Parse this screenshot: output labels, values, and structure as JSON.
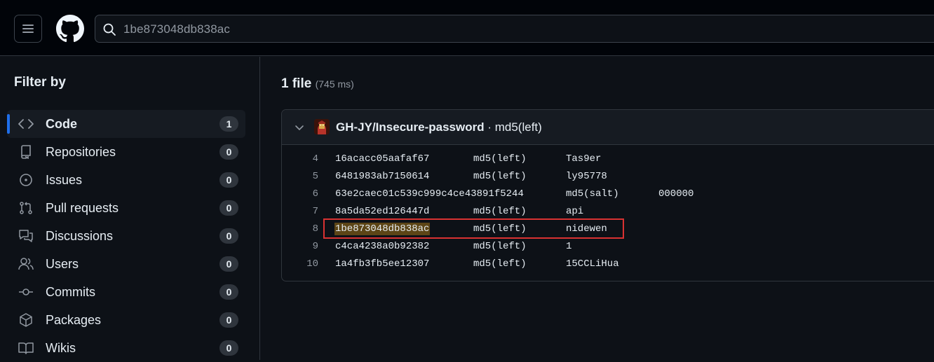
{
  "header": {
    "search_query": "1be873048db838ac",
    "icons": [
      "hamburger-menu-icon",
      "github-logo-icon",
      "search-icon"
    ]
  },
  "sidebar": {
    "title": "Filter by",
    "items": [
      {
        "label": "Code",
        "count": "1",
        "icon": "code-icon",
        "active": true
      },
      {
        "label": "Repositories",
        "count": "0",
        "icon": "repo-icon"
      },
      {
        "label": "Issues",
        "count": "0",
        "icon": "issue-icon"
      },
      {
        "label": "Pull requests",
        "count": "0",
        "icon": "pull-request-icon"
      },
      {
        "label": "Discussions",
        "count": "0",
        "icon": "discussion-icon"
      },
      {
        "label": "Users",
        "count": "0",
        "icon": "users-icon"
      },
      {
        "label": "Commits",
        "count": "0",
        "icon": "commit-icon"
      },
      {
        "label": "Packages",
        "count": "0",
        "icon": "package-icon"
      },
      {
        "label": "Wikis",
        "count": "0",
        "icon": "book-icon"
      }
    ]
  },
  "results": {
    "count_label": "1 file",
    "time_label": "(745 ms)"
  },
  "file": {
    "repo": "GH-JY/Insecure-password",
    "separator": " · ",
    "filename": "md5(left)",
    "lines": [
      {
        "num": "4",
        "c1": "16acacc05aafaf67",
        "c2": "md5(left)",
        "c3": "Tas9er",
        "c4": ""
      },
      {
        "num": "5",
        "c1": "6481983ab7150614",
        "c2": "md5(left)",
        "c3": "ly95778",
        "c4": ""
      },
      {
        "num": "6",
        "c1": "63e2caec01c539c999c4ce43891f5244",
        "c2": "",
        "c3": "md5(salt)",
        "c4": "000000"
      },
      {
        "num": "7",
        "c1": "8a5da52ed126447d",
        "c2": "md5(left)",
        "c3": "api",
        "c4": ""
      },
      {
        "num": "8",
        "c1": "1be873048db838ac",
        "c2": "md5(left)",
        "c3": "nidewen",
        "c4": "",
        "highlight": true
      },
      {
        "num": "9",
        "c1": "c4ca4238a0b92382",
        "c2": "md5(left)",
        "c3": "1",
        "c4": ""
      },
      {
        "num": "10",
        "c1": "1a4fb3fb5ee12307",
        "c2": "md5(left)",
        "c3": "15CCLiHua",
        "c4": ""
      }
    ]
  },
  "colors": {
    "background": "#0d1117",
    "accent": "#1f6feb",
    "highlight": "#5c4516",
    "annotation_box": "#d93232"
  }
}
